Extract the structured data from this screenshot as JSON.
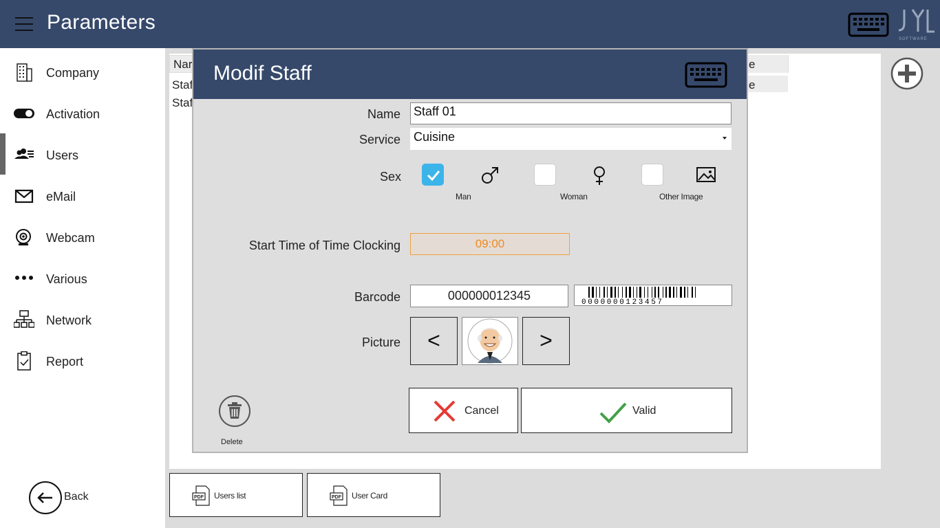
{
  "header": {
    "title": "Parameters",
    "logo_text": "SOFTWARE"
  },
  "sidebar": {
    "items": [
      {
        "label": "Company",
        "icon": "building-icon"
      },
      {
        "label": "Activation",
        "icon": "toggle-icon"
      },
      {
        "label": "Users",
        "icon": "users-icon",
        "active": true
      },
      {
        "label": "eMail",
        "icon": "mail-icon"
      },
      {
        "label": "Webcam",
        "icon": "webcam-icon"
      },
      {
        "label": "Various",
        "icon": "dots-icon"
      },
      {
        "label": "Network",
        "icon": "network-icon"
      },
      {
        "label": "Report",
        "icon": "clipboard-icon"
      }
    ],
    "back_label": "Back"
  },
  "background_table": {
    "header_fragment": "Nar",
    "header_tail": "e",
    "rows": [
      "Staf",
      "Staf"
    ],
    "row_tail": "e"
  },
  "footer_buttons": {
    "users_list": "Users list",
    "user_card": "User Card",
    "pdf_tag": "PDF"
  },
  "modal": {
    "title": "Modif Staff",
    "fields": {
      "name_label": "Name",
      "name_value": "Staff 01",
      "service_label": "Service",
      "service_value": "Cuisine",
      "sex_label": "Sex",
      "sex_options": [
        {
          "label": "Man",
          "checked": true
        },
        {
          "label": "Woman",
          "checked": false
        },
        {
          "label": "Other Image",
          "checked": false
        }
      ],
      "start_time_label": "Start Time of Time Clocking",
      "start_time_value": "09:00",
      "barcode_label": "Barcode",
      "barcode_value": "000000012345",
      "barcode_image_digits": "0000000123457",
      "picture_label": "Picture",
      "prev": "<",
      "next": ">"
    },
    "delete_label": "Delete",
    "cancel_label": "Cancel",
    "valid_label": "Valid"
  },
  "colors": {
    "header_bg": "#36496b",
    "check_blue": "#3bb4ea",
    "time_orange": "#f08a20",
    "cancel_red": "#e53935",
    "valid_green": "#43a047"
  }
}
